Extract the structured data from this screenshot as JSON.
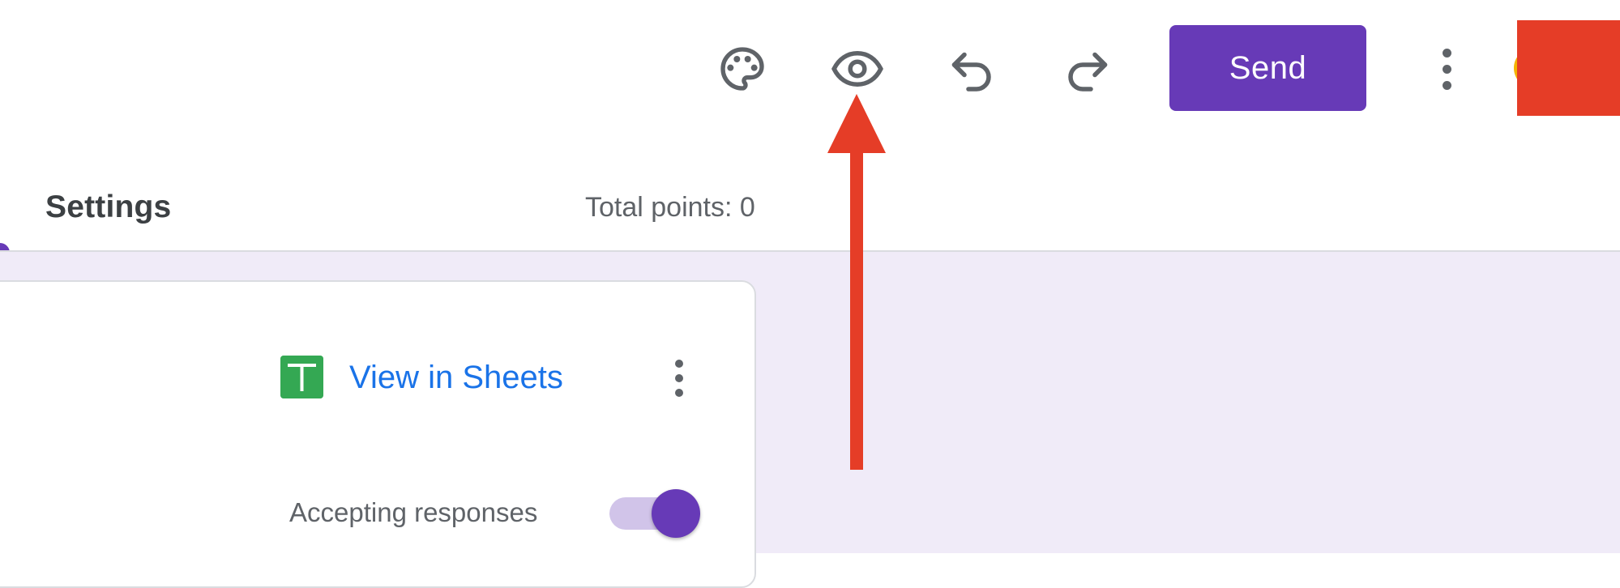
{
  "toolbar": {
    "icons": [
      "palette-icon",
      "eye-icon",
      "undo-icon",
      "redo-icon",
      "more-vert-icon"
    ],
    "send_label": "Send",
    "colors": {
      "accent": "#673ab7",
      "icon": "#5f6368"
    }
  },
  "tabs": {
    "settings_label": "Settings",
    "total_points": "Total points: 0"
  },
  "responses_card": {
    "view_sheets_label": "View in Sheets",
    "accepting_label": "Accepting responses",
    "accepting_on": true,
    "colors": {
      "sheets_green": "#34a853",
      "link_blue": "#1a73e8"
    }
  },
  "annotation": {
    "arrow_color": "#e53d27",
    "points_to": "eye-icon"
  }
}
